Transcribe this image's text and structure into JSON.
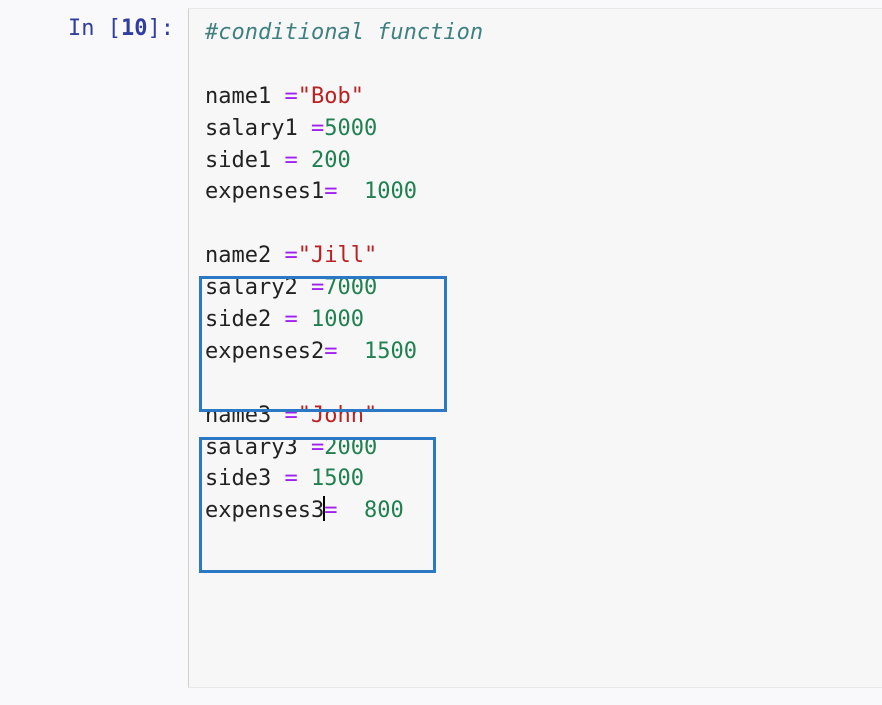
{
  "prompt": {
    "label": "In ",
    "open_bracket": "[",
    "number": "10",
    "close_bracket": "]:"
  },
  "code": {
    "comment": "#conditional function",
    "block1": {
      "l1_var": "name1 ",
      "l1_op": "=",
      "l1_str": "\"Bob\"",
      "l2_var": "salary1 ",
      "l2_op": "=",
      "l2_num": "5000",
      "l3_var": "side1 ",
      "l3_op": "=",
      "l3_num": " 200",
      "l4_var": "expenses1",
      "l4_op": "=",
      "l4_gap": "  ",
      "l4_num": "1000"
    },
    "block2": {
      "l1_var": "name2 ",
      "l1_op": "=",
      "l1_str": "\"Jill\"",
      "l2_var": "salary2 ",
      "l2_op": "=",
      "l2_num": "7000",
      "l3_var": "side2 ",
      "l3_op": "=",
      "l3_num": " 1000",
      "l4_var": "expenses2",
      "l4_op": "=",
      "l4_gap": "  ",
      "l4_num": "1500"
    },
    "block3": {
      "l1_var": "name3 ",
      "l1_op": "=",
      "l1_str": "\"John\"",
      "l2_var": "salary3 ",
      "l2_op": "=",
      "l2_num": "2000",
      "l3_var": "side3 ",
      "l3_op": "=",
      "l3_num": " 1500",
      "l4_var": "expenses3",
      "l4_op": "=",
      "l4_gap": "  ",
      "l4_num": "800"
    }
  }
}
